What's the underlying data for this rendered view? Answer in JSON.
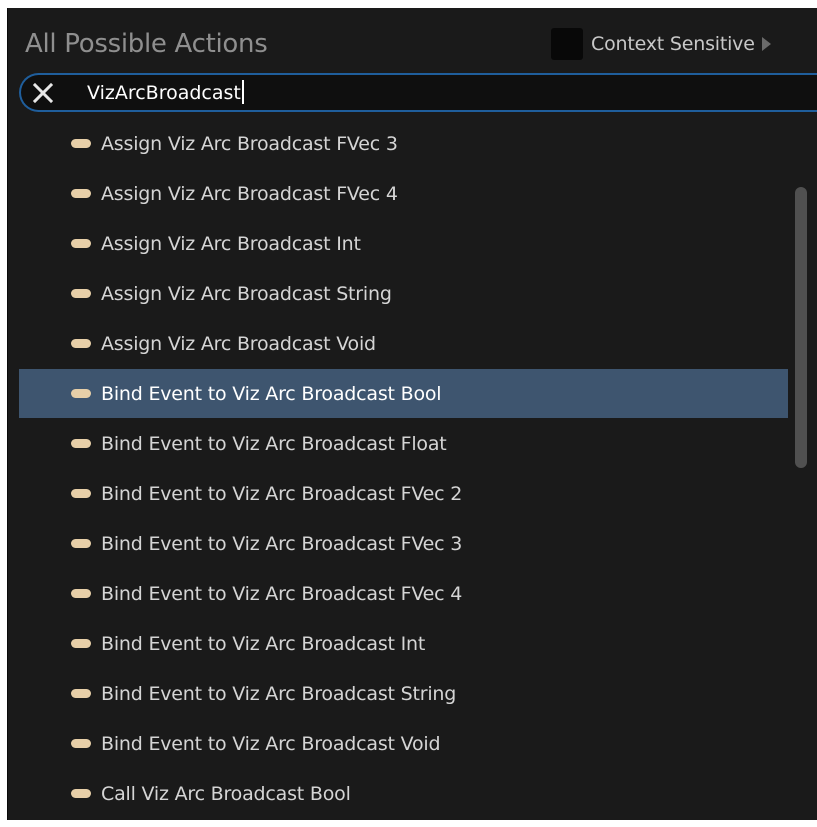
{
  "header": {
    "title": "All Possible Actions",
    "context_sensitive_label": "Context Sensitive",
    "context_sensitive_checked": false
  },
  "search": {
    "value": "VizArcBroadcast",
    "clear_icon": "close-icon"
  },
  "colors": {
    "panel_bg": "#1a1a1a",
    "selection_bg": "#3e556f",
    "search_border": "#1f5e9c",
    "pill": "#e7cfa8"
  },
  "actions": [
    {
      "label": "Assign Viz Arc Broadcast FVec 3",
      "selected": false
    },
    {
      "label": "Assign Viz Arc Broadcast FVec 4",
      "selected": false
    },
    {
      "label": "Assign Viz Arc Broadcast Int",
      "selected": false
    },
    {
      "label": "Assign Viz Arc Broadcast String",
      "selected": false
    },
    {
      "label": "Assign Viz Arc Broadcast Void",
      "selected": false
    },
    {
      "label": "Bind Event to Viz Arc Broadcast Bool",
      "selected": true
    },
    {
      "label": "Bind Event to Viz Arc Broadcast Float",
      "selected": false
    },
    {
      "label": "Bind Event to Viz Arc Broadcast FVec 2",
      "selected": false
    },
    {
      "label": "Bind Event to Viz Arc Broadcast FVec 3",
      "selected": false
    },
    {
      "label": "Bind Event to Viz Arc Broadcast FVec 4",
      "selected": false
    },
    {
      "label": "Bind Event to Viz Arc Broadcast Int",
      "selected": false
    },
    {
      "label": "Bind Event to Viz Arc Broadcast String",
      "selected": false
    },
    {
      "label": "Bind Event to Viz Arc Broadcast Void",
      "selected": false
    },
    {
      "label": "Call Viz Arc Broadcast Bool",
      "selected": false
    }
  ]
}
